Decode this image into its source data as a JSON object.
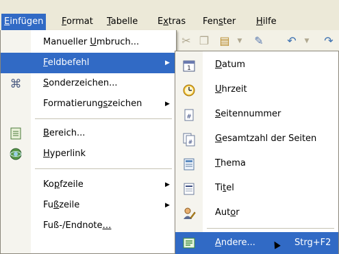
{
  "menubar": {
    "items": [
      {
        "pre": "",
        "acc": "E",
        "post": "infügen"
      },
      {
        "pre": "",
        "acc": "F",
        "post": "ormat"
      },
      {
        "pre": "",
        "acc": "T",
        "post": "abelle"
      },
      {
        "pre": "E",
        "acc": "x",
        "post": "tras"
      },
      {
        "pre": "Fen",
        "acc": "s",
        "post": "ter"
      },
      {
        "pre": "",
        "acc": "H",
        "post": "ilfe"
      }
    ]
  },
  "main_menu": {
    "items": [
      {
        "pre": "Manueller ",
        "acc": "U",
        "post": "mbruch..."
      },
      {
        "pre": "",
        "acc": "F",
        "post": "eldbefehl"
      },
      {
        "pre": "",
        "acc": "S",
        "post": "onderzeichen..."
      },
      {
        "pre": "Formatierung",
        "acc": "s",
        "post": "zeichen"
      },
      {
        "pre": "",
        "acc": "B",
        "post": "ereich..."
      },
      {
        "pre": "",
        "acc": "H",
        "post": "yperlink"
      },
      {
        "pre": "Ko",
        "acc": "p",
        "post": "fzeile"
      },
      {
        "pre": "Fu",
        "acc": "ß",
        "post": "zeile"
      },
      {
        "pre": "Fuß-/Endnote",
        "acc": "…",
        "post": ""
      }
    ]
  },
  "submenu": {
    "items": [
      {
        "pre": "",
        "acc": "D",
        "post": "atum",
        "icon": "calendar-icon"
      },
      {
        "pre": "",
        "acc": "U",
        "post": "hrzeit",
        "icon": "clock-icon"
      },
      {
        "pre": "",
        "acc": "S",
        "post": "eitennummer",
        "icon": "page-number-icon"
      },
      {
        "pre": "",
        "acc": "G",
        "post": "esamtzahl der Seiten",
        "icon": "page-count-icon"
      },
      {
        "pre": "",
        "acc": "T",
        "post": "hema",
        "icon": "subject-icon"
      },
      {
        "pre": "Ti",
        "acc": "t",
        "post": "el",
        "icon": "title-icon"
      },
      {
        "pre": "Aut",
        "acc": "o",
        "post": "r",
        "icon": "author-icon"
      },
      {
        "pre": "",
        "acc": "A",
        "post": "ndere...",
        "icon": "other-fields-icon",
        "shortcut": "Strg+F2"
      }
    ]
  },
  "colors": {
    "highlight": "#316ac5",
    "menu_bg": "#ffffff",
    "gutter": "#f5f4ee"
  }
}
